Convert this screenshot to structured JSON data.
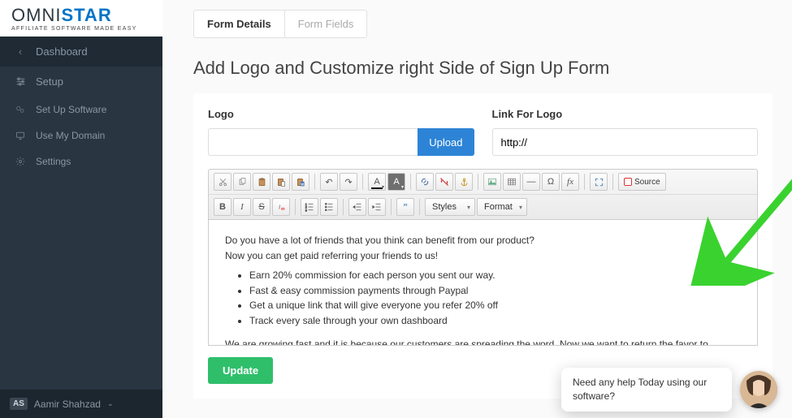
{
  "logo": {
    "brand_a": "OMNI",
    "brand_b": "STAR",
    "sub": "AFFILIATE SOFTWARE MADE EASY"
  },
  "sidebar": {
    "dashboard": "Dashboard",
    "setup": "Setup",
    "items": [
      {
        "label": "Set Up Software"
      },
      {
        "label": "Use My Domain"
      },
      {
        "label": "Settings"
      }
    ]
  },
  "user": {
    "initials": "AS",
    "name": "Aamir Shahzad"
  },
  "tabs": {
    "details": "Form Details",
    "fields": "Form Fields"
  },
  "page": {
    "title": "Add Logo and Customize right Side of Sign Up Form"
  },
  "form": {
    "logo_label": "Logo",
    "upload_label": "Upload",
    "link_label": "Link For Logo",
    "link_value": "http://",
    "update_label": "Update"
  },
  "editor_toolbar": {
    "styles": "Styles",
    "format": "Format",
    "source": "Source"
  },
  "editor": {
    "p1": "Do you have a lot of friends that you think can benefit from our product?",
    "p2": "Now you can get paid referring your friends to us!",
    "bullets": [
      "Earn 20% commission for each person you sent our way.",
      "Fast & easy commission payments through Paypal",
      "Get a unique link that will give everyone you refer 20% off",
      "Track every sale through your own dashboard"
    ],
    "p3": "We are growing fast and it is because our customers are spreading the word. Now we want to return the favor to everyone that has helped us. Start getting paid today!"
  },
  "chat": {
    "msg": "Need any help Today using our software?"
  }
}
